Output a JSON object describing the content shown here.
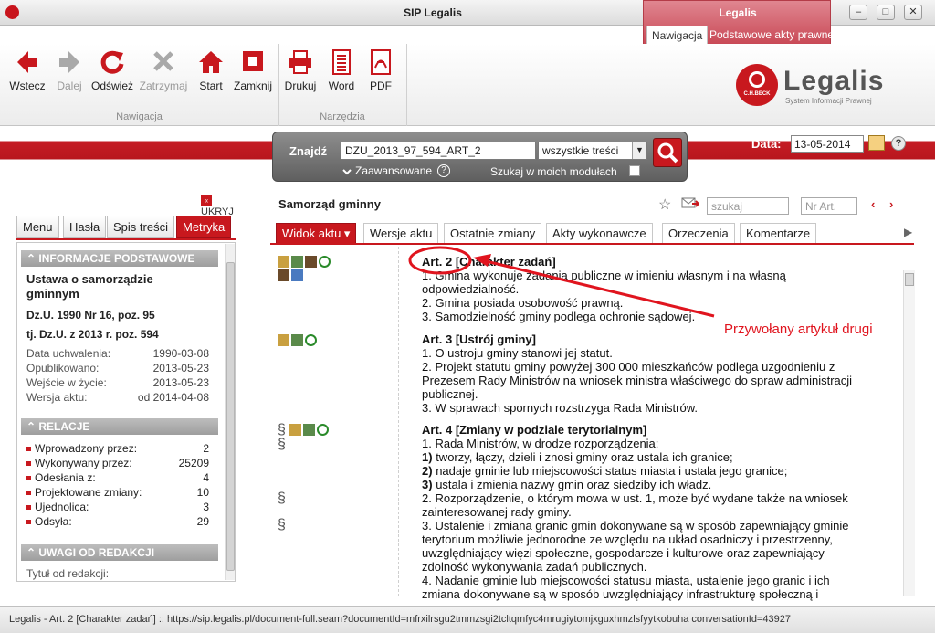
{
  "window": {
    "title": "SIP Legalis",
    "legalis_tab": "Legalis",
    "ribbon_tabs": [
      "Nawigacja",
      "Podstawowe akty prawne"
    ],
    "controls": {
      "minimize": "–",
      "maximize": "□",
      "close": "✕"
    }
  },
  "ribbon": {
    "nav_buttons": [
      {
        "label": "Wstecz",
        "icon": "back-arrow-icon",
        "enabled": true
      },
      {
        "label": "Dalej",
        "icon": "forward-arrow-icon",
        "enabled": false
      },
      {
        "label": "Odśwież",
        "icon": "refresh-icon",
        "enabled": true
      },
      {
        "label": "Zatrzymaj",
        "icon": "stop-x-icon",
        "enabled": false
      },
      {
        "label": "Start",
        "icon": "home-icon",
        "enabled": true
      },
      {
        "label": "Zamknij",
        "icon": "close-square-icon",
        "enabled": true
      }
    ],
    "tool_buttons": [
      {
        "label": "Drukuj",
        "icon": "printer-icon"
      },
      {
        "label": "Word",
        "icon": "word-document-icon"
      },
      {
        "label": "PDF",
        "icon": "pdf-icon"
      }
    ],
    "group_nav": "Nawigacja",
    "group_tools": "Narzędzia",
    "logo": {
      "name": "Legalis",
      "subtitle": "System Informacji Prawnej",
      "emblem_text": "C.H.BECK"
    }
  },
  "search": {
    "label": "Znajdź",
    "value": "DZU_2013_97_594_ART_2",
    "scope": "wszystkie treści",
    "advanced": "Zaawansowane",
    "my_modules": "Szukaj w moich modułach",
    "date_label": "Data:",
    "date_value": "13-05-2014"
  },
  "left_panel": {
    "collapse_label": "UKRYJ",
    "tabs": [
      "Menu",
      "Hasła",
      "Spis treści",
      "Metryka"
    ],
    "section_basic": "INFORMACJE PODSTAWOWE",
    "act_title": "Ustawa o samorządzie gminnym",
    "act_ref": "Dz.U. 1990 Nr 16, poz. 95",
    "act_consolidated": "tj. Dz.U. z 2013 r. poz. 594",
    "dates": [
      {
        "label": "Data uchwalenia:",
        "value": "1990-03-08"
      },
      {
        "label": "Opublikowano:",
        "value": "2013-05-23"
      },
      {
        "label": "Wejście w życie:",
        "value": "2013-05-23"
      },
      {
        "label": "Wersja aktu:",
        "value": "od 2014-04-08"
      }
    ],
    "section_relations": "RELACJE",
    "relations": [
      {
        "label": "Wprowadzony przez:",
        "value": "2"
      },
      {
        "label": "Wykonywany przez:",
        "value": "25209"
      },
      {
        "label": "Odesłania z:",
        "value": "4"
      },
      {
        "label": "Projektowane zmiany:",
        "value": "10"
      },
      {
        "label": "Ujednolica:",
        "value": "3"
      },
      {
        "label": "Odsyła:",
        "value": "29"
      }
    ],
    "section_notes": "UWAGI OD REDAKCJI",
    "notes_title_label": "Tytuł od redakcji:"
  },
  "document": {
    "title": "Samorząd gminny",
    "search_placeholder": "szukaj",
    "art_placeholder": "Nr Art.",
    "tabs": [
      "Widok aktu ▾",
      "Wersje aktu",
      "Ostatnie zmiany",
      "Akty wykonawcze",
      "Orzeczenia",
      "Komentarze"
    ],
    "art2": {
      "heading": "Art. 2 [Charakter zadań]",
      "lines": [
        "1. Gmina wykonuje zadania publiczne w imieniu własnym i na własną",
        "odpowiedzialność.",
        "2. Gmina posiada osobowość prawną.",
        "3. Samodzielność gminy podlega ochronie sądowej."
      ]
    },
    "art3": {
      "heading": "Art. 3 [Ustrój gminy]",
      "lines": [
        "1. O ustroju gminy stanowi jej statut.",
        "2. Projekt statutu gminy powyżej 300 000 mieszkańców podlega uzgodnieniu z",
        "Prezesem Rady Ministrów na wniosek ministra właściwego do spraw administracji",
        "publicznej.",
        "3. W sprawach spornych rozstrzyga Rada Ministrów."
      ]
    },
    "art4": {
      "heading": "Art. 4 [Zmiany w podziale terytorialnym]",
      "line1": "1. Rada Ministrów, w drodze rozporządzenia:",
      "points": [
        {
          "num": "1)",
          "text": "tworzy, łączy, dzieli i znosi gminy oraz ustala ich granice;"
        },
        {
          "num": "2)",
          "text": "nadaje gminie lub miejscowości status miasta i ustala jego granice;"
        },
        {
          "num": "3)",
          "text": "ustala i zmienia nazwy gmin oraz siedziby ich władz."
        }
      ],
      "rest": [
        "2. Rozporządzenie, o którym mowa w ust. 1, może być wydane także na wniosek",
        "zainteresowanej rady gminy.",
        "3. Ustalenie i zmiana granic gmin dokonywane są w sposób zapewniający gminie",
        "terytorium możliwie jednorodne ze względu na układ osadniczy i przestrzenny,",
        "uwzględniający więzi społeczne, gospodarcze i kulturowe oraz zapewniający",
        "zdolność wykonywania zadań publicznych.",
        "4. Nadanie gminie lub miejscowości statusu miasta, ustalenie jego granic i ich",
        "zmiana dokonywane są w sposób uwzględniający infrastrukturę społeczną i"
      ]
    },
    "section_sign": "§"
  },
  "annotation": {
    "text": "Przywołany artykuł drugi",
    "color": "#e0141e"
  },
  "statusbar": {
    "text": "Legalis - Art. 2 [Charakter zadań] :: https://sip.legalis.pl/document-full.seam?documentId=mfrxilrsgu2tmmzsgi2tcltqmfyc4mrugiytomjxguxhmzlsfyytkobuha conversationId=43927"
  },
  "colors": {
    "accent": "#c8181e",
    "annotation": "#e0141e"
  }
}
